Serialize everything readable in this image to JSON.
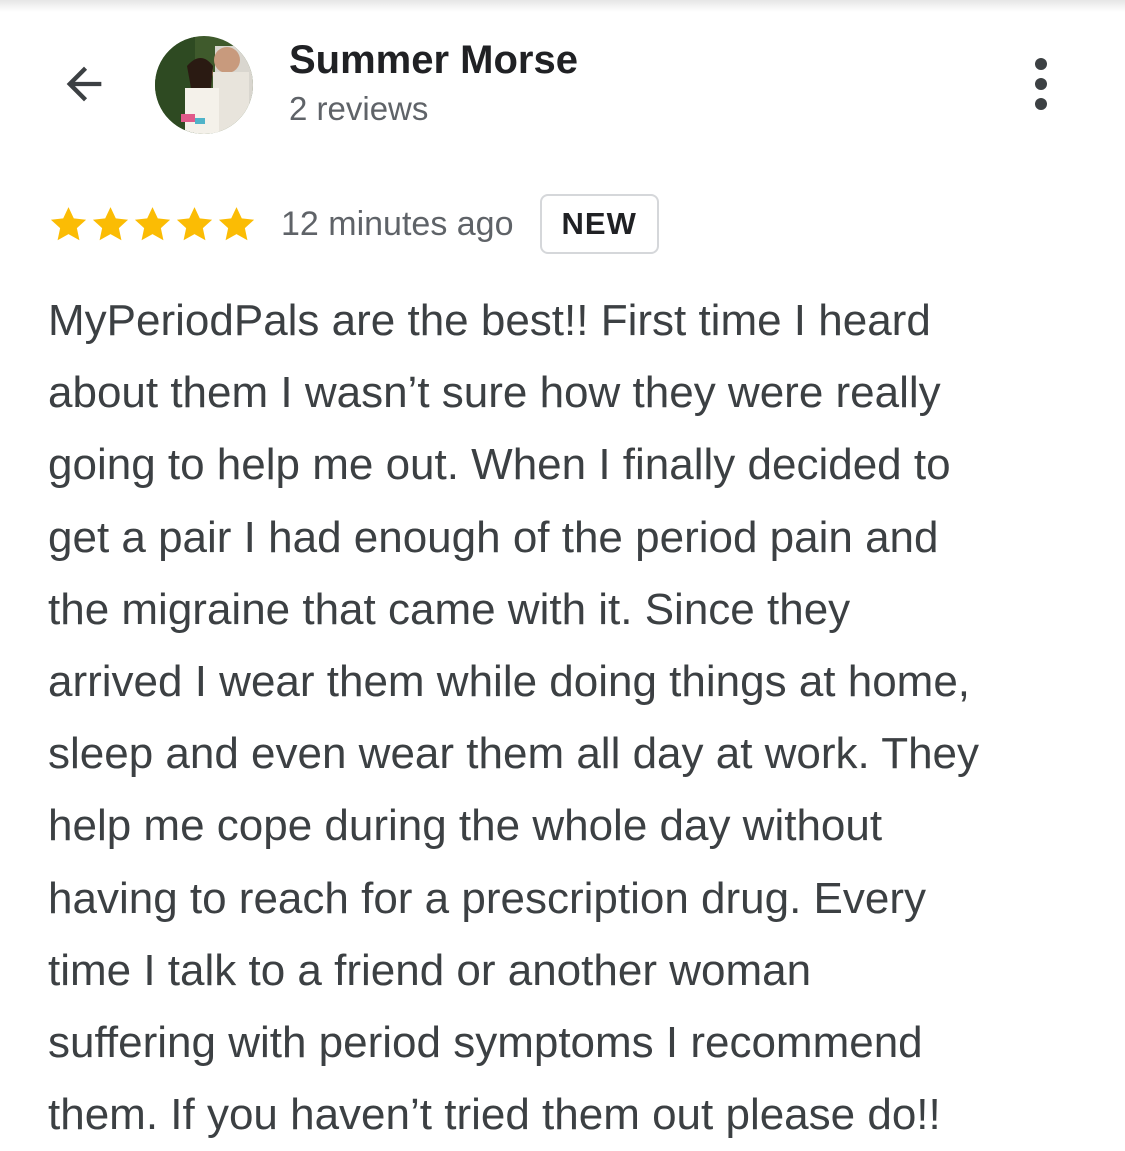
{
  "header": {
    "reviewer_name": "Summer Morse",
    "review_count": "2 reviews",
    "back_icon": "arrow-left-icon",
    "more_icon": "more-vert-icon",
    "avatar": "avatar-photo"
  },
  "review": {
    "rating": 5,
    "rating_max": 5,
    "star_color": "#fbbc04",
    "timestamp": "12 minutes ago",
    "badge": "NEW",
    "lines": [
      "MyPeriodPals are the best!! First time I heard",
      "about them I wasn’t sure how they were really",
      "going to help me out. When I finally decided to",
      "get a pair I had enough of the period pain and",
      "the migraine that came with it. Since they",
      "arrived I wear them while doing things at home,",
      "sleep and even wear them all day at work. They",
      "help me cope during the whole day without",
      "having to reach for a prescription drug. Every",
      "time I talk to a friend or another woman",
      "suffering with period symptoms I recommend",
      "them. If you haven’t tried them out please do!!"
    ]
  }
}
